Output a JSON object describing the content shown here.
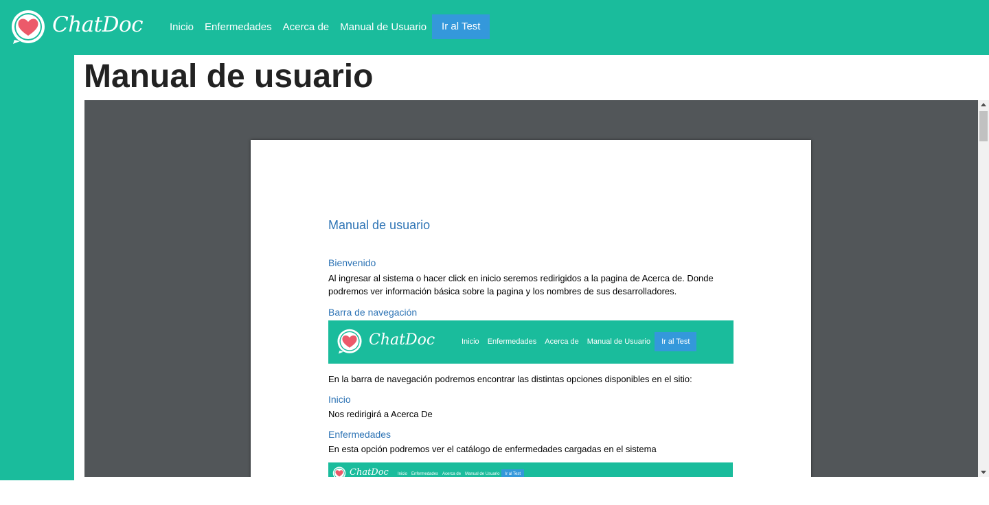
{
  "navbar": {
    "brand": "ChatDoc",
    "links": [
      "Inicio",
      "Enfermedades",
      "Acerca de",
      "Manual de Usuario"
    ],
    "cta": "Ir al Test",
    "color": "#1abc9c",
    "cta_color": "#3498db"
  },
  "page": {
    "title": "Manual de usuario"
  },
  "document": {
    "title": "Manual de usuario",
    "sections": {
      "bienvenido_heading": "Bienvenido",
      "bienvenido_text": "Al ingresar al sistema o hacer click en inicio seremos redirigidos a la pagina de Acerca de. Donde podremos ver información básica sobre la pagina y los nombres de sus desarrolladores.",
      "barra_heading": "Barra de navegación",
      "barra_text": "En la barra de navegación  podremos encontrar las distintas opciones disponibles en el sitio:",
      "inicio_heading": "Inicio",
      "inicio_text": "Nos redirigirá a Acerca De",
      "enfermedades_heading": "Enfermedades",
      "enfermedades_text": "En esta opción podremos ver el catálogo de enfermedades cargadas en el sistema"
    },
    "screenshot_nav": {
      "brand": "ChatDoc",
      "links": [
        "Inicio",
        "Enfermedades",
        "Acerca de",
        "Manual de Usuario"
      ],
      "cta": "Ir al Test"
    }
  }
}
